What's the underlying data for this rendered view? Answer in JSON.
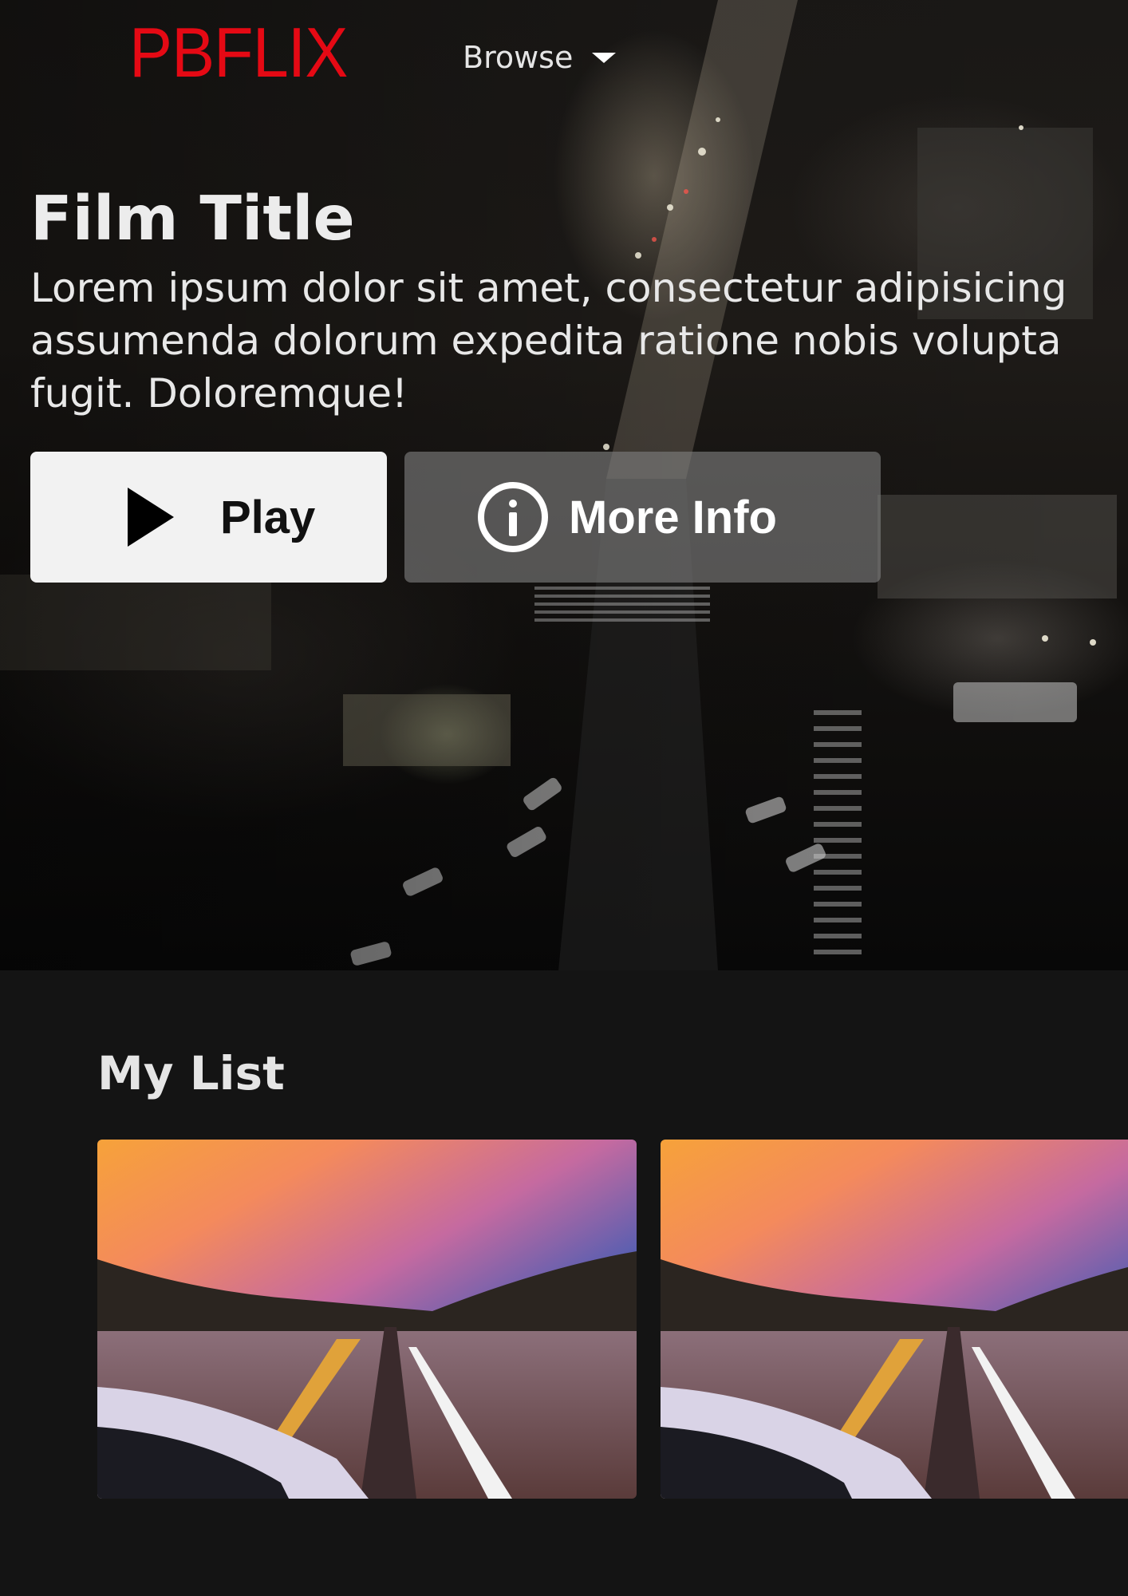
{
  "nav": {
    "logo": "PBFLIX",
    "browse_label": "Browse"
  },
  "hero": {
    "title": "Film Title",
    "description": "Lorem ipsum dolor sit amet, consectetur adipisicing\nassumenda dolorum expedita ratione nobis volupta\nfugit. Doloremque!",
    "play_label": "Play",
    "info_label": "More Info"
  },
  "my_list": {
    "title": "My List",
    "items": [
      {
        "thumbnail": "highway-sunset-image"
      },
      {
        "thumbnail": "highway-sunset-image"
      }
    ]
  },
  "colors": {
    "brand": "#e50914",
    "background": "#141414",
    "play_button": "#f2f2f2",
    "info_button": "rgba(128,128,128,0.62)"
  },
  "icons": {
    "browse_caret": "caret-down-icon",
    "play": "play-icon",
    "info": "info-icon"
  }
}
